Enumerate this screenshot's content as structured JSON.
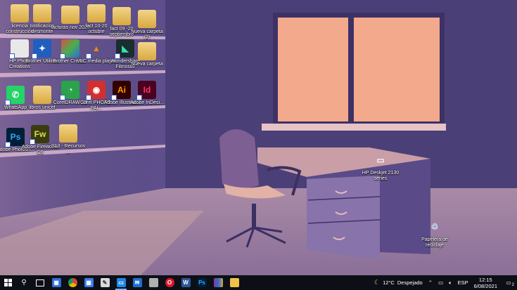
{
  "desktop_icons": [
    {
      "name": "icon-licencia-construccion",
      "label": "licencia construcción",
      "kind": "folder"
    },
    {
      "name": "icon-notificacion-desmonte",
      "label": "notificacion desmonte",
      "kind": "folder"
    },
    {
      "name": "icon-facturas-nov-2020",
      "label": "facturas nov 2020",
      "kind": "folder"
    },
    {
      "name": "icon-fact-10-20-octubre",
      "label": "fact 10-20 octubre",
      "kind": "folder"
    },
    {
      "name": "icon-fact-09-20-septiembre",
      "label": "fact 09 -20 septiembre",
      "kind": "folder"
    },
    {
      "name": "icon-nueva-carpeta-2",
      "label": "Nueva carpeta (2)",
      "kind": "folder"
    },
    {
      "name": "icon-hp-photo-creations",
      "label": "HP Photo Creations",
      "kind": "app"
    },
    {
      "name": "icon-brother-utilities",
      "label": "Brother Utilities",
      "kind": "app"
    },
    {
      "name": "icon-brother-creative",
      "label": "Brother Creati...",
      "kind": "app"
    },
    {
      "name": "icon-vlc-media-player",
      "label": "VLC media player",
      "kind": "app"
    },
    {
      "name": "icon-wondershare-filmora9",
      "label": "Wondershare Filmora9",
      "kind": "app"
    },
    {
      "name": "icon-nueva-carpeta",
      "label": "Nueva carpeta",
      "kind": "folder"
    },
    {
      "name": "icon-whatsapp",
      "label": "WhatsApp",
      "kind": "app"
    },
    {
      "name": "icon-libros-unicef",
      "label": "libros unicef",
      "kind": "folder"
    },
    {
      "name": "icon-coreldraw-x8",
      "label": "CorelDRAW X8",
      "kind": "app"
    },
    {
      "name": "icon-corel-photo-paint",
      "label": "Corel PHOTO-PAI...",
      "kind": "app"
    },
    {
      "name": "icon-adobe-illustrator",
      "label": "Adobe Illustrat...",
      "kind": "app"
    },
    {
      "name": "icon-adobe-indesign",
      "label": "Adobe InDesi...",
      "kind": "app"
    },
    {
      "name": "icon-adobe-photoshop",
      "label": "Adobe Photosh...",
      "kind": "app"
    },
    {
      "name": "icon-adobe-fireworks-cs",
      "label": "Adobe Fireworks CS",
      "kind": "app"
    },
    {
      "name": "icon-s13-recursos",
      "label": "S13 - Recursos ...",
      "kind": "folder"
    },
    {
      "name": "icon-hp-deskjet",
      "label": "HP Deskjet 2130 series",
      "kind": "app"
    },
    {
      "name": "icon-papelera-reciclaje",
      "label": "Papelera de reciclaje",
      "kind": "app"
    }
  ],
  "glyphs": {
    "ai": "Ai",
    "id": "Id",
    "ps": "Ps",
    "fw": "Fw",
    "w": "W",
    "ps2": "Ps"
  },
  "taskbar": {
    "items": [
      {
        "name": "start-button",
        "icon": "windows-icon"
      },
      {
        "name": "search-button",
        "icon": "search-icon"
      },
      {
        "name": "task-view-button",
        "icon": "task-view-icon"
      },
      {
        "name": "taskbar-store",
        "icon": "store-icon"
      },
      {
        "name": "taskbar-chrome",
        "icon": "chrome-icon"
      },
      {
        "name": "taskbar-app-blue",
        "icon": "app-grid-icon"
      },
      {
        "name": "taskbar-brush",
        "icon": "paint-icon"
      },
      {
        "name": "taskbar-explorer",
        "icon": "folder-window-icon"
      },
      {
        "name": "taskbar-mail",
        "icon": "mail-icon"
      },
      {
        "name": "taskbar-drive",
        "icon": "drive-icon"
      },
      {
        "name": "taskbar-opera",
        "icon": "opera-icon"
      },
      {
        "name": "taskbar-word",
        "icon": "word-icon"
      },
      {
        "name": "taskbar-photoshop",
        "icon": "photoshop-icon"
      },
      {
        "name": "taskbar-winrar",
        "icon": "winrar-icon"
      },
      {
        "name": "taskbar-file-explorer",
        "icon": "folder-icon"
      }
    ],
    "weather_temp": "12°C",
    "weather_text": "Despejado",
    "language": "ESP",
    "time": "12:15",
    "date": "6/08/2021",
    "notification_count": "2"
  },
  "colors": {
    "accent": "#7fb3ff",
    "window_glow": "#f5a98a",
    "taskbar": "#0d0f17"
  }
}
